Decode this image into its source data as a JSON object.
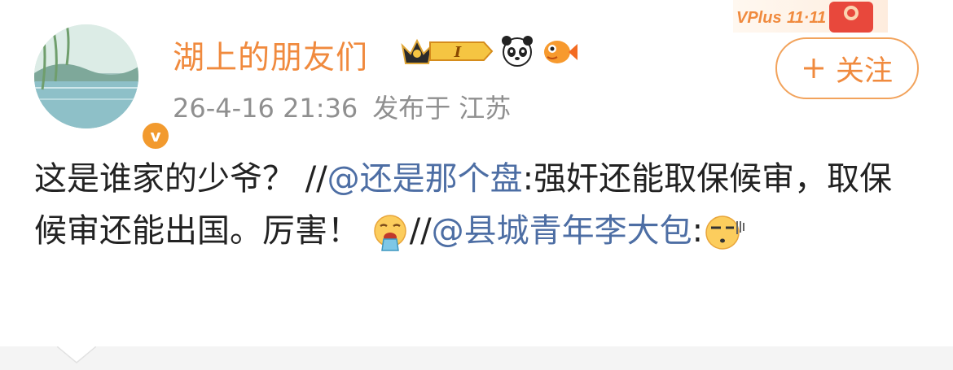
{
  "post": {
    "username": "湖上的朋友们",
    "timestamp": "26-4-16 21:36",
    "source_prefix": "发布于",
    "location": "江苏",
    "follow_label": "关注",
    "vplus_label": "VPlus",
    "vplus_date": "11·11",
    "verify_glyph": "v",
    "level_label": "I",
    "segments": [
      {
        "text": "这是谁家的少爷？ //",
        "type": "text"
      },
      {
        "text": "@还是那个盘",
        "type": "mention"
      },
      {
        "text": ":强奸还能取保候审，取保候审还能出国。厉害！ ",
        "type": "text"
      },
      {
        "text": "//",
        "type": "text"
      },
      {
        "text": "@县城青年李大包",
        "type": "mention"
      },
      {
        "text": ":",
        "type": "text"
      }
    ]
  },
  "icons": [
    "crown-badge-icon",
    "panda-icon",
    "fish-icon",
    "vomit-emoji-icon",
    "speechless-emoji-icon",
    "plus-icon"
  ],
  "colors": {
    "username": "#f08a3e",
    "mention": "#4d6ea4",
    "meta": "#8f8f8f",
    "follow_border": "#f2a35c"
  }
}
